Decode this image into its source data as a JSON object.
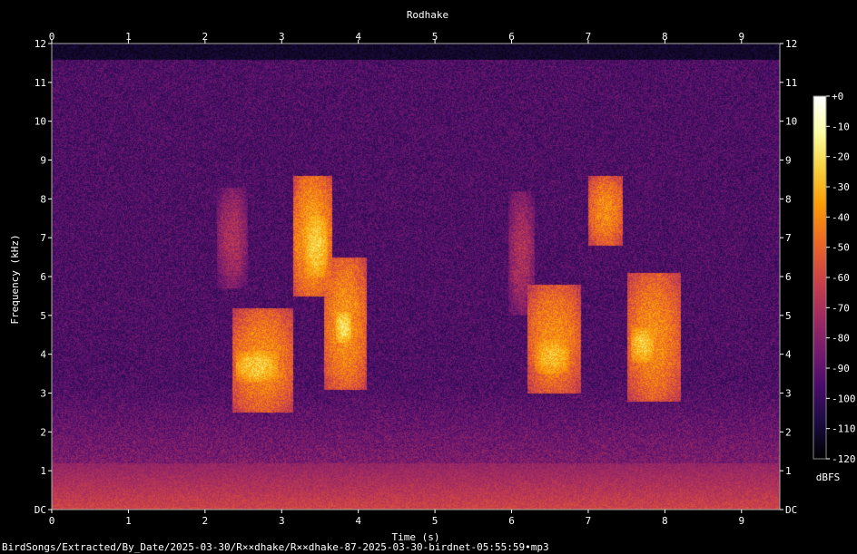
{
  "chart_data": {
    "type": "heatmap",
    "title": "Rodhake",
    "xlabel": "Time (s)",
    "ylabel": "Frequency (kHz)",
    "xlim": [
      0,
      9.5
    ],
    "ylim": [
      0,
      12
    ],
    "x_ticks": [
      "0",
      "1",
      "2",
      "3",
      "4",
      "5",
      "6",
      "7",
      "8",
      "9"
    ],
    "y_ticks": [
      "DC",
      "1",
      "2",
      "3",
      "4",
      "5",
      "6",
      "7",
      "8",
      "9",
      "10",
      "11",
      "12"
    ],
    "colorbar": {
      "label": "dBFS",
      "ticks": [
        "+0",
        "-10",
        "-20",
        "-30",
        "-40",
        "-50",
        "-60",
        "-70",
        "-80",
        "-90",
        "-100",
        "-110",
        "-120"
      ],
      "range": [
        -120,
        0
      ],
      "colormap": [
        "#000000",
        "#1b0c41",
        "#4a0c6b",
        "#781c6d",
        "#a52c60",
        "#cf4446",
        "#ed6925",
        "#fb9b06",
        "#f7d13d",
        "#fcffa4",
        "#ffffff"
      ]
    },
    "bursts": [
      {
        "t0": 2.15,
        "t1": 2.55,
        "f0": 5.7,
        "f1": 8.3,
        "level": -70
      },
      {
        "t0": 2.35,
        "t1": 3.15,
        "f0": 2.5,
        "f1": 5.2,
        "level": -40
      },
      {
        "t0": 2.4,
        "t1": 2.95,
        "f0": 3.3,
        "f1": 4.1,
        "level": -25
      },
      {
        "t0": 3.15,
        "t1": 3.65,
        "f0": 5.5,
        "f1": 8.6,
        "level": -35
      },
      {
        "t0": 3.3,
        "t1": 3.6,
        "f0": 6.0,
        "f1": 7.6,
        "level": -25
      },
      {
        "t0": 3.55,
        "t1": 4.1,
        "f0": 3.1,
        "f1": 6.5,
        "level": -38
      },
      {
        "t0": 3.7,
        "t1": 3.9,
        "f0": 4.3,
        "f1": 5.1,
        "level": -20
      },
      {
        "t0": 5.95,
        "t1": 6.3,
        "f0": 5.0,
        "f1": 8.2,
        "level": -70
      },
      {
        "t0": 6.2,
        "t1": 6.9,
        "f0": 3.0,
        "f1": 5.8,
        "level": -40
      },
      {
        "t0": 6.3,
        "t1": 6.75,
        "f0": 3.5,
        "f1": 4.4,
        "level": -28
      },
      {
        "t0": 7.0,
        "t1": 7.45,
        "f0": 6.8,
        "f1": 8.6,
        "level": -40
      },
      {
        "t0": 7.5,
        "t1": 8.2,
        "f0": 2.8,
        "f1": 6.1,
        "level": -40
      },
      {
        "t0": 7.55,
        "t1": 7.85,
        "f0": 3.8,
        "f1": 4.7,
        "level": -25
      }
    ],
    "background_level": -95,
    "low_frequency_band": {
      "f0": 0,
      "f1": 1.2,
      "level": -60
    },
    "grid": false
  },
  "footer": {
    "path": "BirdSongs/Extracted/By_Date/2025-03-30/R××dhake/R××dhake-87-2025-03-30-birdnet-05:55:59•mp3"
  }
}
